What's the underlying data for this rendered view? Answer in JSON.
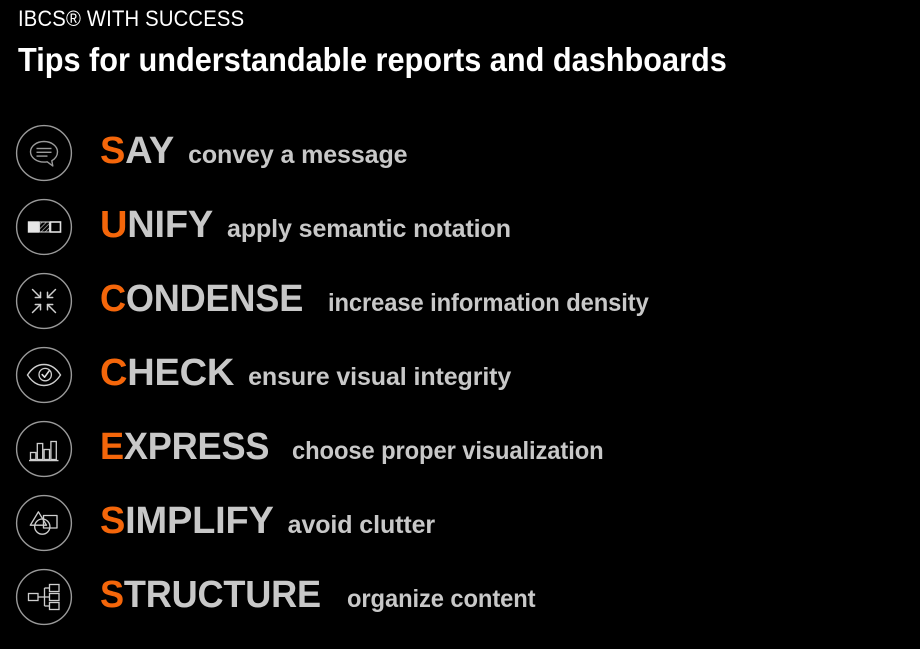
{
  "header": {
    "eyebrow": "IBCS® WITH SUCCESS",
    "headline": "Tips for understandable reports and dashboards"
  },
  "colors": {
    "background": "#000000",
    "accent_orange": "#f4660a",
    "text_gray": "#c8c8c8",
    "heading_white": "#ffffff",
    "icon_stroke": "#9a9a9a"
  },
  "rows": [
    {
      "icon": "speech-bubble-icon",
      "lead": "S",
      "rest": "AY",
      "description": "convey a message",
      "length": "short"
    },
    {
      "icon": "semantic-notation-squares-icon",
      "lead": "U",
      "rest": "NIFY",
      "description": "apply semantic notation",
      "length": "short"
    },
    {
      "icon": "converging-arrows-icon",
      "lead": "C",
      "rest": "ONDENSE",
      "description": "increase information density",
      "length": "long"
    },
    {
      "icon": "eye-check-icon",
      "lead": "C",
      "rest": "HECK",
      "description": "ensure visual integrity",
      "length": "short"
    },
    {
      "icon": "bar-chart-icon",
      "lead": "E",
      "rest": "XPRESS",
      "description": "choose proper visualization",
      "length": "long"
    },
    {
      "icon": "shapes-icon",
      "lead": "S",
      "rest": "IMPLIFY",
      "description": "avoid clutter",
      "length": "short"
    },
    {
      "icon": "org-tree-icon",
      "lead": "S",
      "rest": "TRUCTURE",
      "description": "organize content",
      "length": "long"
    }
  ]
}
